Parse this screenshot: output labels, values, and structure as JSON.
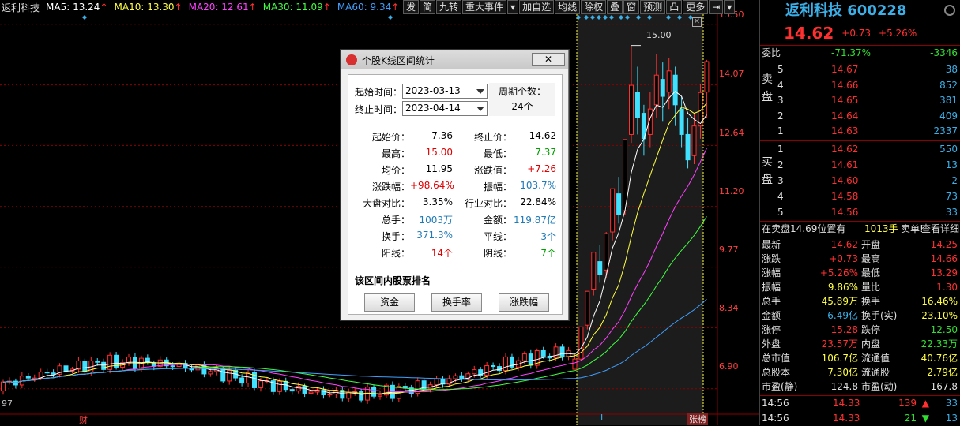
{
  "ma_bar": {
    "name": "返利科技",
    "ma5": "MA5: 13.24",
    "ma10": "MA10: 13.30",
    "ma20": "MA20: 12.61",
    "ma30": "MA30: 11.09",
    "ma60": "MA60: 9.34",
    "arrow": "↑"
  },
  "toolbar": [
    "发",
    "简",
    "九转",
    "重大事件",
    "▾",
    "加自选",
    "均线",
    "除权",
    "叠",
    "窗",
    "预测",
    "凸",
    "更多",
    "⇥",
    "▾"
  ],
  "y_ticks": [
    "15.50",
    "14.07",
    "12.64",
    "11.20",
    "9.77",
    "8.34",
    "6.90"
  ],
  "bottom": {
    "left_label": "97",
    "cai": "财",
    "L": "L",
    "zhangbang": "张榜",
    "high_label": "15.00"
  },
  "dialog": {
    "title": "个股K线区间统计",
    "close": "✕",
    "start_label": "起始时间：",
    "end_label": "终止时间：",
    "start_date": "2023-03-13",
    "end_date": "2023-04-14",
    "period_label": "周期个数：",
    "period_value": "24个",
    "stats": [
      {
        "l": "起始价：",
        "v": "7.36",
        "c": "blk",
        "l2": "终止价：",
        "v2": "14.62",
        "c2": "blk"
      },
      {
        "l": "最高：",
        "v": "15.00",
        "c": "red",
        "l2": "最低：",
        "v2": "7.37",
        "c2": "grn"
      },
      {
        "l": "均价：",
        "v": "11.95",
        "c": "blk",
        "l2": "涨跌值：",
        "v2": "+7.26",
        "c2": "red"
      },
      {
        "l": "涨跌幅：",
        "v": "+98.64%",
        "c": "red",
        "l2": "振幅：",
        "v2": "103.7%",
        "c2": "blu"
      },
      {
        "l": "大盘对比：",
        "v": "3.35%",
        "c": "blk",
        "l2": "行业对比：",
        "v2": "22.84%",
        "c2": "blk"
      },
      {
        "l": "总手：",
        "v": "1003万",
        "c": "blu",
        "l2": "金额：",
        "v2": "119.87亿",
        "c2": "blu"
      },
      {
        "l": "换手：",
        "v": "371.3%",
        "c": "blu",
        "l2": "平线：",
        "v2": "3个",
        "c2": "blu"
      },
      {
        "l": "阳线：",
        "v": "14个",
        "c": "red",
        "l2": "阴线：",
        "v2": "7个",
        "c2": "grn"
      }
    ],
    "rank_title": "该区间内股票排名",
    "btn_fund": "资金",
    "btn_turnover": "换手率",
    "btn_change": "涨跌幅"
  },
  "quote": {
    "title": "返利科技 600228",
    "price": "14.62",
    "change": "+0.73",
    "pct": "+5.26%",
    "weibi_label": "委比",
    "weibi_pct": "-71.37%",
    "weibi_val": "-3346",
    "sell_label": [
      "卖",
      "盘"
    ],
    "buy_label": [
      "买",
      "盘"
    ],
    "sells": [
      {
        "n": "5",
        "p": "14.67",
        "v": "38"
      },
      {
        "n": "4",
        "p": "14.66",
        "v": "852"
      },
      {
        "n": "3",
        "p": "14.65",
        "v": "381"
      },
      {
        "n": "2",
        "p": "14.64",
        "v": "409"
      },
      {
        "n": "1",
        "p": "14.63",
        "v": "2337"
      }
    ],
    "buys": [
      {
        "n": "1",
        "p": "14.62",
        "v": "550"
      },
      {
        "n": "2",
        "p": "14.61",
        "v": "13"
      },
      {
        "n": "3",
        "p": "14.60",
        "v": "2"
      },
      {
        "n": "4",
        "p": "14.58",
        "v": "73"
      },
      {
        "n": "5",
        "p": "14.56",
        "v": "33"
      }
    ],
    "notice_a": "在卖盘14.69位置有",
    "notice_b": "1013手",
    "notice_c": "卖单!",
    "notice_link": "查看详细",
    "stats": [
      {
        "l1": "最新",
        "v1": "14.62",
        "c1": "rd",
        "l2": "开盘",
        "v2": "14.25",
        "c2": "rd"
      },
      {
        "l1": "涨跌",
        "v1": "+0.73",
        "c1": "rd",
        "l2": "最高",
        "v2": "14.66",
        "c2": "rd"
      },
      {
        "l1": "涨幅",
        "v1": "+5.26%",
        "c1": "rd",
        "l2": "最低",
        "v2": "13.29",
        "c2": "rd"
      },
      {
        "l1": "振幅",
        "v1": "9.86%",
        "c1": "yl",
        "l2": "量比",
        "v2": "1.30",
        "c2": "rd"
      },
      {
        "l1": "总手",
        "v1": "45.89万",
        "c1": "yl",
        "l2": "换手",
        "v2": "16.46%",
        "c2": "yl"
      },
      {
        "l1": "金额",
        "v1": "6.49亿",
        "c1": "cy",
        "l2": "换手(实)",
        "v2": "23.10%",
        "c2": "yl"
      },
      {
        "l1": "涨停",
        "v1": "15.28",
        "c1": "rd",
        "l2": "跌停",
        "v2": "12.50",
        "c2": "gr"
      },
      {
        "l1": "外盘",
        "v1": "23.57万",
        "c1": "rd",
        "l2": "内盘",
        "v2": "22.33万",
        "c2": "gr"
      },
      {
        "l1": "总市值",
        "v1": "106.7亿",
        "c1": "yl",
        "l2": "流通值",
        "v2": "40.76亿",
        "c2": "yl"
      },
      {
        "l1": "总股本",
        "v1": "7.30亿",
        "c1": "yl",
        "l2": "流通股",
        "v2": "2.79亿",
        "c2": "yl"
      },
      {
        "l1": "市盈(静)",
        "v1": "124.8",
        "c1": "wh",
        "l2": "市盈(动)",
        "v2": "167.8",
        "c2": "wh"
      }
    ],
    "ticks": [
      {
        "t": "14:56",
        "p": "14.33",
        "v": "139",
        "d": "▲",
        "n": "33",
        "dc": "rd"
      },
      {
        "t": "14:56",
        "p": "14.33",
        "v": "21",
        "d": "▼",
        "n": "13",
        "dc": "gr"
      }
    ]
  },
  "chart_data": {
    "type": "candlestick",
    "highlight_range": [
      "2023-03-13",
      "2023-04-14"
    ],
    "y_range": [
      6.3,
      15.7
    ],
    "y_ticks": [
      15.5,
      14.07,
      12.64,
      11.2,
      9.77,
      8.34,
      6.9
    ],
    "highlight_candles": [
      {
        "o": 7.36,
        "c": 7.6,
        "h": 7.7,
        "l": 7.37
      },
      {
        "o": 7.6,
        "c": 8.36,
        "h": 8.36,
        "l": 7.55
      },
      {
        "o": 8.4,
        "c": 9.2,
        "h": 9.2,
        "l": 8.3
      },
      {
        "o": 9.25,
        "c": 10.12,
        "h": 10.12,
        "l": 9.1
      },
      {
        "o": 9.9,
        "c": 9.6,
        "h": 10.3,
        "l": 9.4
      },
      {
        "o": 9.7,
        "c": 10.56,
        "h": 10.6,
        "l": 9.5
      },
      {
        "o": 10.6,
        "c": 11.62,
        "h": 11.62,
        "l": 10.4
      },
      {
        "o": 11.5,
        "c": 11.0,
        "h": 11.9,
        "l": 10.8
      },
      {
        "o": 11.1,
        "c": 12.78,
        "h": 12.78,
        "l": 11.0
      },
      {
        "o": 12.9,
        "c": 14.06,
        "h": 15.0,
        "l": 12.7
      },
      {
        "o": 13.9,
        "c": 13.3,
        "h": 14.5,
        "l": 12.9
      },
      {
        "o": 13.4,
        "c": 12.8,
        "h": 13.6,
        "l": 12.4
      },
      {
        "o": 12.9,
        "c": 13.5,
        "h": 13.9,
        "l": 12.6
      },
      {
        "o": 13.6,
        "c": 14.3,
        "h": 14.8,
        "l": 13.3
      },
      {
        "o": 14.2,
        "c": 13.8,
        "h": 14.6,
        "l": 13.2
      },
      {
        "o": 13.9,
        "c": 14.4,
        "h": 14.7,
        "l": 13.5
      },
      {
        "o": 14.3,
        "c": 13.6,
        "h": 14.5,
        "l": 13.1
      },
      {
        "o": 13.5,
        "c": 12.9,
        "h": 13.8,
        "l": 12.6
      },
      {
        "o": 12.9,
        "c": 12.3,
        "h": 13.3,
        "l": 12.1
      },
      {
        "o": 12.4,
        "c": 13.1,
        "h": 13.4,
        "l": 12.2
      },
      {
        "o": 13.1,
        "c": 13.89,
        "h": 14.1,
        "l": 12.8
      },
      {
        "o": 13.9,
        "c": 14.62,
        "h": 14.66,
        "l": 13.29
      }
    ],
    "ma_legend": [
      "MA5",
      "MA10",
      "MA20",
      "MA30",
      "MA60"
    ],
    "ma_colors": [
      "#ffffff",
      "#ffff40",
      "#ff40ff",
      "#40ff40",
      "#40a0ff"
    ],
    "up_color": "#ff3030",
    "down_color": "#40e0ff"
  }
}
